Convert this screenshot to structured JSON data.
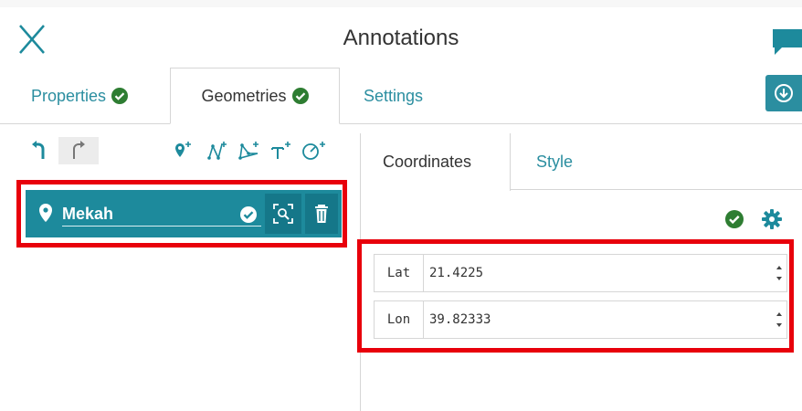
{
  "dialog": {
    "title": "Annotations"
  },
  "tabs": [
    {
      "label": "Properties",
      "active": false
    },
    {
      "label": "Geometries",
      "active": true
    },
    {
      "label": "Settings",
      "active": false
    }
  ],
  "colors": {
    "accent": "#1d8a9c",
    "accent_dark": "#157789",
    "link": "#2b8ea0",
    "ok_green": "#2e7d32",
    "highlight": "#e8000b"
  },
  "tools": [
    "undo-icon",
    "redo-icon",
    "add-point-icon",
    "add-line-icon",
    "add-polygon-icon",
    "add-text-icon",
    "add-circle-icon"
  ],
  "geometry": {
    "name": "Mekah",
    "type_icon": "map-pin-icon"
  },
  "subtabs": [
    {
      "label": "Coordinates",
      "active": true
    },
    {
      "label": "Style",
      "active": false
    }
  ],
  "coordinates": [
    {
      "label": "Lat",
      "value": "21.4225"
    },
    {
      "label": "Lon",
      "value": "39.82333"
    }
  ]
}
